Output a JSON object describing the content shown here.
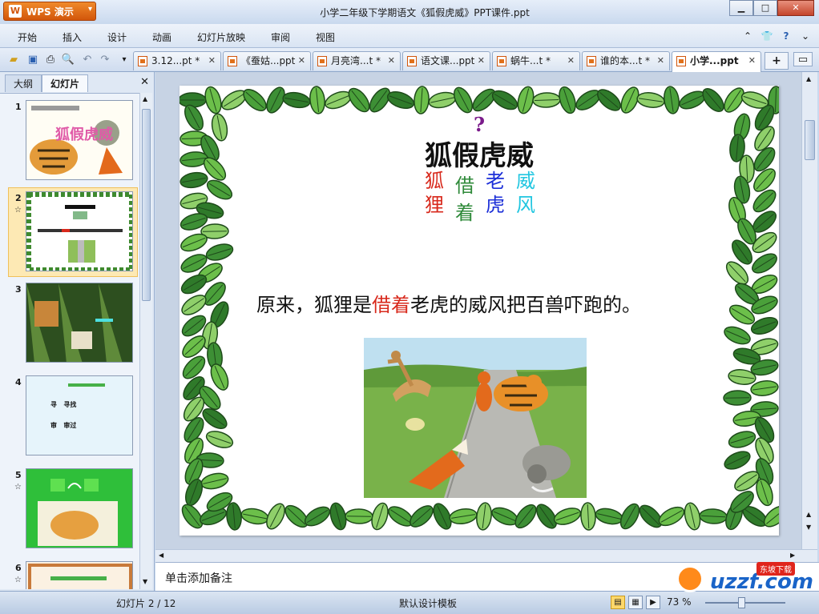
{
  "app": {
    "button_label": "WPS 演示",
    "window_title": "小学二年级下学期语文《狐假虎威》PPT课件.ppt",
    "window_controls": [
      "▁",
      "□",
      "✕"
    ]
  },
  "menu": [
    "开始",
    "插入",
    "设计",
    "动画",
    "幻灯片放映",
    "审阅",
    "视图"
  ],
  "tabs": [
    {
      "label": "3.12...pt *"
    },
    {
      "label": "《蚕姑...ppt"
    },
    {
      "label": "月亮湾...t *"
    },
    {
      "label": "语文课...ppt"
    },
    {
      "label": "蜗牛...t *"
    },
    {
      "label": "谁的本...t *"
    },
    {
      "label": "小学...ppt"
    }
  ],
  "left_panel": {
    "tab_outline": "大纲",
    "tab_slides": "幻灯片",
    "close": "✕",
    "thumbs": [
      {
        "num": "1",
        "star": ""
      },
      {
        "num": "2",
        "star": "☆"
      },
      {
        "num": "3",
        "star": ""
      },
      {
        "num": "4",
        "star": ""
      },
      {
        "num": "5",
        "star": "☆"
      },
      {
        "num": "6",
        "star": "☆"
      }
    ],
    "thumb4": {
      "rows": [
        [
          "寻",
          "寻找"
        ],
        [
          "审",
          "审过"
        ]
      ]
    }
  },
  "slide": {
    "question_mark": "?",
    "title": "狐假虎威",
    "columns": [
      {
        "chars": [
          "狐",
          "狸"
        ],
        "color": "#d8291c"
      },
      {
        "chars": [
          "借",
          "着"
        ],
        "color": "#2f8a3a"
      },
      {
        "chars": [
          "老",
          "虎"
        ],
        "color": "#1c2fd8"
      },
      {
        "chars": [
          "威",
          "风"
        ],
        "color": "#21c6e0"
      }
    ],
    "sentence_pre": "原来，狐狸是",
    "sentence_highlight": "借着",
    "sentence_post": "老虎的威风把百兽吓跑的。"
  },
  "notes_placeholder": "单击添加备注",
  "status": {
    "slide_indicator": "幻灯片 2 / 12",
    "template": "默认设计模板",
    "zoom": "73 %"
  },
  "watermark": {
    "text": "uzzf.com",
    "badge": "东坡下载"
  }
}
